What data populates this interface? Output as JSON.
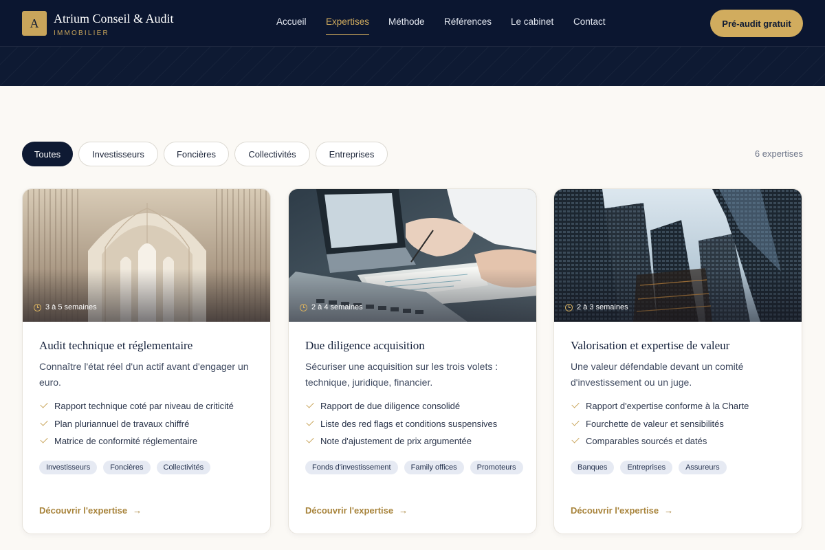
{
  "brand": {
    "mark": "A",
    "name": "Atrium Conseil & Audit",
    "subtitle": "IMMOBILIER",
    "color": "#c9a55b"
  },
  "nav": {
    "items": [
      {
        "label": "Accueil"
      },
      {
        "label": "Expertises",
        "active": true
      },
      {
        "label": "Méthode"
      },
      {
        "label": "Références"
      },
      {
        "label": "Le cabinet"
      },
      {
        "label": "Contact"
      }
    ],
    "cta": "Pré-audit gratuit"
  },
  "filters": {
    "chips": [
      {
        "label": "Toutes",
        "active": true
      },
      {
        "label": "Investisseurs"
      },
      {
        "label": "Foncières"
      },
      {
        "label": "Collectivités"
      },
      {
        "label": "Entreprises"
      }
    ],
    "count": "6 expertises"
  },
  "cards": [
    {
      "duration": "3 à 5 semaines",
      "title": "Audit technique et réglementaire",
      "description": "Connaître l'état réel d'un actif avant d'engager un euro.",
      "items": [
        "Rapport technique coté par niveau de criticité",
        "Plan pluriannuel de travaux chiffré",
        "Matrice de conformité réglementaire"
      ],
      "tags": [
        "Investisseurs",
        "Foncières",
        "Collectivités"
      ],
      "link": "Découvrir l'expertise",
      "image": "cathedral-arches"
    },
    {
      "duration": "2 à 4 semaines",
      "title": "Due diligence acquisition",
      "description": "Sécuriser une acquisition sur les trois volets : technique, juridique, financier.",
      "items": [
        "Rapport de due diligence consolidé",
        "Liste des red flags et conditions suspensives",
        "Note d'ajustement de prix argumentée"
      ],
      "tags": [
        "Fonds d'investissement",
        "Family offices",
        "Promoteurs"
      ],
      "link": "Découvrir l'expertise",
      "image": "laptop-documents"
    },
    {
      "duration": "2 à 3 semaines",
      "title": "Valorisation et expertise de valeur",
      "description": "Une valeur défendable devant un comité d'investissement ou un juge.",
      "items": [
        "Rapport d'expertise conforme à la Charte",
        "Fourchette de valeur et sensibilités",
        "Comparables sourcés et datés"
      ],
      "tags": [
        "Banques",
        "Entreprises",
        "Assureurs"
      ],
      "link": "Découvrir l'expertise",
      "image": "skyscrapers"
    }
  ],
  "colors": {
    "navy": "#0e1a33",
    "gold": "#c9a55b",
    "background": "#fbf9f5",
    "tag": "#e6eaf3"
  }
}
